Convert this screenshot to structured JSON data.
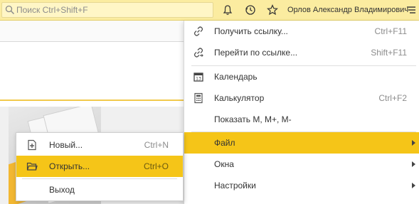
{
  "search": {
    "placeholder": "Поиск Ctrl+Shift+F",
    "icon": "magnifier-icon"
  },
  "toolbar": {
    "icons": [
      "bell-icon",
      "history-icon",
      "star-icon",
      "menu-icon"
    ],
    "user_name": "Орлов Александр Владимирович"
  },
  "menu": {
    "items": [
      {
        "label": "Получить ссылку...",
        "shortcut": "Ctrl+F11",
        "icon": "link-icon"
      },
      {
        "label": "Перейти по ссылке...",
        "shortcut": "Shift+F11",
        "icon": "link-go-icon"
      },
      {
        "label": "Календарь",
        "shortcut": "",
        "icon": "calendar-icon"
      },
      {
        "label": "Калькулятор",
        "shortcut": "Ctrl+F2",
        "icon": "calculator-icon"
      },
      {
        "label": "Показать M, M+, M-",
        "shortcut": "",
        "icon": ""
      },
      {
        "label": "Файл",
        "shortcut": "",
        "icon": "",
        "submenu": true,
        "active": true
      },
      {
        "label": "Окна",
        "shortcut": "",
        "icon": "",
        "submenu": true
      },
      {
        "label": "Настройки",
        "shortcut": "",
        "icon": "",
        "submenu": true
      }
    ]
  },
  "submenu": {
    "items": [
      {
        "label": "Новый...",
        "shortcut": "Ctrl+N",
        "icon": "new-file-icon"
      },
      {
        "label": "Открыть...",
        "shortcut": "Ctrl+O",
        "icon": "open-folder-icon",
        "active": true
      },
      {
        "label": "Выход",
        "shortcut": "",
        "icon": ""
      }
    ]
  },
  "colors": {
    "accent": "#f5c518",
    "topbar": "#fbeca0"
  }
}
